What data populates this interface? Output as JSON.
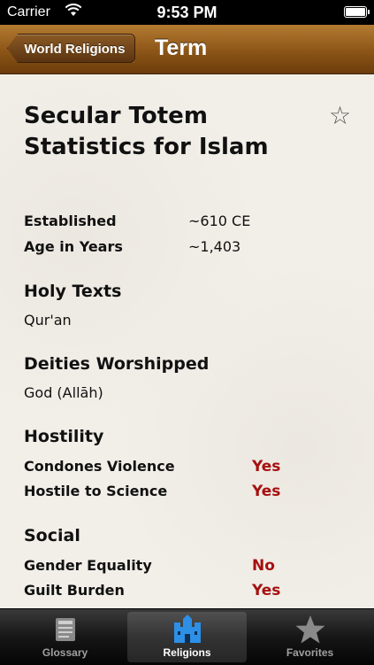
{
  "status": {
    "carrier": "Carrier",
    "time": "9:53 PM"
  },
  "nav": {
    "back_label": "World Religions",
    "title": "Term"
  },
  "title": "Secular Totem Statistics for Islam",
  "established": {
    "label": "Established",
    "value": "~610 CE"
  },
  "age": {
    "label": "Age in Years",
    "value": "~1,403"
  },
  "holy_texts": {
    "heading": "Holy Texts",
    "value": "Qur'an"
  },
  "deities": {
    "heading": "Deities Worshipped",
    "value": "God (Allāh)"
  },
  "hostility": {
    "heading": "Hostility",
    "rows": [
      {
        "label": "Condones Violence",
        "value": "Yes"
      },
      {
        "label": "Hostile to Science",
        "value": "Yes"
      }
    ]
  },
  "social": {
    "heading": "Social",
    "rows": [
      {
        "label": "Gender Equality",
        "value": "No"
      },
      {
        "label": "Guilt Burden",
        "value": "Yes"
      }
    ]
  },
  "tabs": [
    {
      "label": "Glossary",
      "icon": "book-icon"
    },
    {
      "label": "Religions",
      "icon": "castle-icon",
      "selected": true
    },
    {
      "label": "Favorites",
      "icon": "star-icon"
    }
  ],
  "colors": {
    "nav_brown": "#8c5517",
    "answer_red": "#a51010",
    "selected_tab_icon": "#2d8fe6"
  }
}
